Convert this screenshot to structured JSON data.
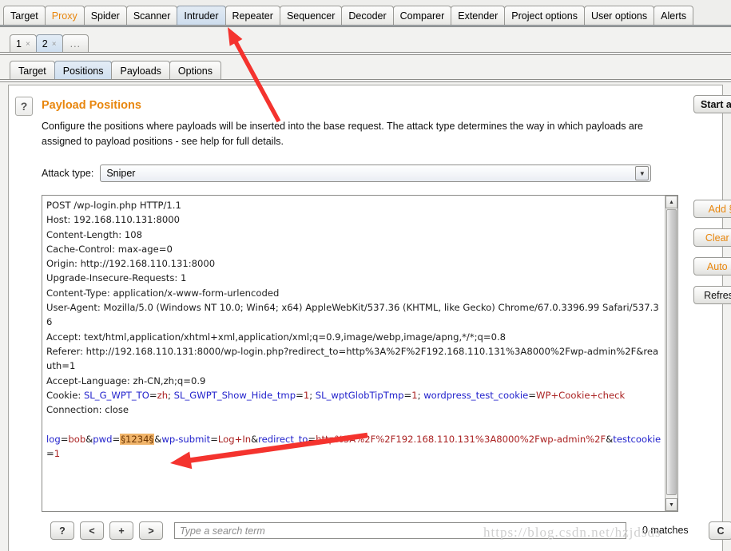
{
  "main_tabs": [
    {
      "label": "Target",
      "state": "normal"
    },
    {
      "label": "Proxy",
      "state": "orange"
    },
    {
      "label": "Spider",
      "state": "normal"
    },
    {
      "label": "Scanner",
      "state": "normal"
    },
    {
      "label": "Intruder",
      "state": "active"
    },
    {
      "label": "Repeater",
      "state": "normal"
    },
    {
      "label": "Sequencer",
      "state": "normal"
    },
    {
      "label": "Decoder",
      "state": "normal"
    },
    {
      "label": "Comparer",
      "state": "normal"
    },
    {
      "label": "Extender",
      "state": "normal"
    },
    {
      "label": "Project options",
      "state": "normal"
    },
    {
      "label": "User options",
      "state": "normal"
    },
    {
      "label": "Alerts",
      "state": "normal"
    }
  ],
  "attack_tabs": [
    {
      "label": "1",
      "close": "×",
      "active": false
    },
    {
      "label": "2",
      "close": "×",
      "active": true
    },
    {
      "label": "...",
      "close": "",
      "active": false
    }
  ],
  "inner_tabs": [
    {
      "label": "Target",
      "active": false
    },
    {
      "label": "Positions",
      "active": true
    },
    {
      "label": "Payloads",
      "active": false
    },
    {
      "label": "Options",
      "active": false
    }
  ],
  "section": {
    "help_icon": "question-mark-icon",
    "help_glyph": "?",
    "title": "Payload Positions",
    "description": "Configure the positions where payloads will be inserted into the base request. The attack type determines the way in which payloads are assigned to payload positions - see help for full details.",
    "title_color": "#e8860d"
  },
  "attack_type": {
    "label": "Attack type:",
    "value": "Sniper",
    "arrow_glyph": "▼"
  },
  "side_buttons": {
    "start_attack": "Start attack",
    "add": "Add §",
    "clear": "Clear §",
    "auto": "Auto §",
    "refresh": "Refresh"
  },
  "request": {
    "lines": [
      [
        {
          "t": "POST /wp-login.php HTTP/1.1",
          "c": "hname"
        }
      ],
      [
        {
          "t": "Host: 192.168.110.131:8000",
          "c": "hname"
        }
      ],
      [
        {
          "t": "Content-Length: 108",
          "c": "hname"
        }
      ],
      [
        {
          "t": "Cache-Control: max-age=0",
          "c": "hname"
        }
      ],
      [
        {
          "t": "Origin: http://192.168.110.131:8000",
          "c": "hname"
        }
      ],
      [
        {
          "t": "Upgrade-Insecure-Requests: 1",
          "c": "hname"
        }
      ],
      [
        {
          "t": "Content-Type: application/x-www-form-urlencoded",
          "c": "hname"
        }
      ],
      [
        {
          "t": "User-Agent: Mozilla/5.0 (Windows NT 10.0; Win64; x64) AppleWebKit/537.36 (KHTML, like Gecko) Chrome/67.0.3396.99 Safari/537.36",
          "c": "hname"
        }
      ],
      [
        {
          "t": "Accept: text/html,application/xhtml+xml,application/xml;q=0.9,image/webp,image/apng,*/*;q=0.8",
          "c": "hname"
        }
      ],
      [
        {
          "t": "Referer: http://192.168.110.131:8000/wp-login.php?redirect_to=http%3A%2F%2F192.168.110.131%3A8000%2Fwp-admin%2F&reauth=1",
          "c": "hname"
        }
      ],
      [
        {
          "t": "Accept-Language: zh-CN,zh;q=0.9",
          "c": "hname"
        }
      ],
      [
        {
          "t": "Cookie: ",
          "c": "hname"
        },
        {
          "t": "SL_G_WPT_TO",
          "c": "cname"
        },
        {
          "t": "=",
          "c": "hname"
        },
        {
          "t": "zh",
          "c": "cval"
        },
        {
          "t": "; ",
          "c": "hname"
        },
        {
          "t": "SL_GWPT_Show_Hide_tmp",
          "c": "cname"
        },
        {
          "t": "=",
          "c": "hname"
        },
        {
          "t": "1",
          "c": "cval"
        },
        {
          "t": "; ",
          "c": "hname"
        },
        {
          "t": "SL_wptGlobTipTmp",
          "c": "cname"
        },
        {
          "t": "=",
          "c": "hname"
        },
        {
          "t": "1",
          "c": "cval"
        },
        {
          "t": "; ",
          "c": "hname"
        },
        {
          "t": "wordpress_test_cookie",
          "c": "cname"
        },
        {
          "t": "=",
          "c": "hname"
        },
        {
          "t": "WP+Cookie+check",
          "c": "cval"
        }
      ],
      [
        {
          "t": "Connection: close",
          "c": "hname"
        }
      ],
      [
        {
          "t": "",
          "c": "hname"
        }
      ],
      [
        {
          "t": "log",
          "c": "pkey"
        },
        {
          "t": "=",
          "c": "hname"
        },
        {
          "t": "bob",
          "c": "purl"
        },
        {
          "t": "&",
          "c": "hname"
        },
        {
          "t": "pwd",
          "c": "pkey"
        },
        {
          "t": "=",
          "c": "hname"
        },
        {
          "t": "§1234§",
          "c": "marker"
        },
        {
          "t": "&",
          "c": "hname"
        },
        {
          "t": "wp-submit",
          "c": "pkey"
        },
        {
          "t": "=",
          "c": "hname"
        },
        {
          "t": "Log+In",
          "c": "purl"
        },
        {
          "t": "&",
          "c": "hname"
        },
        {
          "t": "redirect_to",
          "c": "pkey"
        },
        {
          "t": "=",
          "c": "hname"
        },
        {
          "t": "http%3A%2F%2F192.168.110.131%3A8000%2Fwp-admin%2F",
          "c": "purl"
        },
        {
          "t": "&",
          "c": "hname"
        },
        {
          "t": "testcookie",
          "c": "pkey"
        },
        {
          "t": "=",
          "c": "hname"
        },
        {
          "t": "1",
          "c": "purl"
        }
      ]
    ]
  },
  "bottom_bar": {
    "help_button": "?",
    "prev_button": "<",
    "plus_button": "+",
    "next_button": ">",
    "search_placeholder": "Type a search term",
    "search_value": "",
    "matches": "0 matches",
    "case_button": "C"
  },
  "scrollbar": {
    "up_glyph": "▲",
    "down_glyph": "▼"
  },
  "watermark": "https://blog.csdn.net/hzjdsds",
  "annotations": {
    "arrow_color": "#f4332e",
    "arrow_1_target": "intruder-tab",
    "arrow_2_target": "payload-marker"
  }
}
